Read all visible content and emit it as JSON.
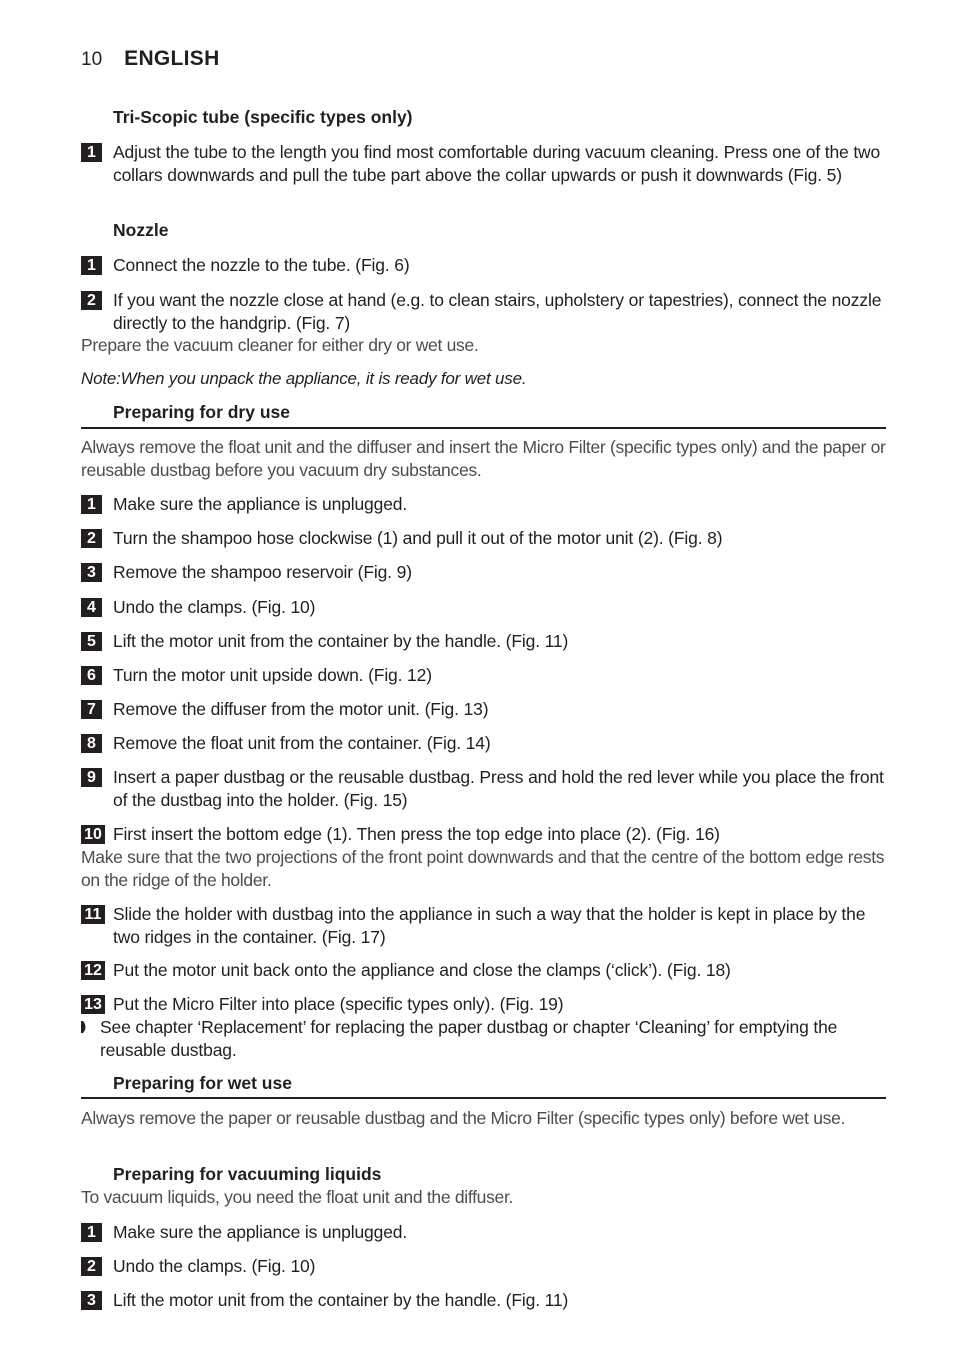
{
  "header": {
    "page_number": "10",
    "language": "ENGLISH"
  },
  "sections": {
    "tri_scopic": {
      "title": "Tri-Scopic tube (specific types only)",
      "steps": [
        {
          "num": "1",
          "text": "Adjust the tube to the length you find most comfortable during vacuum cleaning. Press one of the two collars downwards and pull the tube part above the collar upwards or push it downwards (Fig. 5)"
        }
      ]
    },
    "nozzle": {
      "title": "Nozzle",
      "steps": [
        {
          "num": "1",
          "text": "Connect the nozzle to the tube. (Fig. 6)"
        },
        {
          "num": "2",
          "text": "If you want the nozzle close at hand (e.g. to clean stairs, upholstery or tapestries), connect the nozzle directly to the handgrip. (Fig. 7)"
        }
      ],
      "after_text": "Prepare the vacuum cleaner for either dry or wet use.",
      "note": "Note:When you unpack the appliance, it is ready for wet use."
    },
    "dry_use": {
      "title": "Preparing for dry use",
      "intro": "Always remove the float unit and the diffuser and insert the Micro Filter (specific types only) and the paper or reusable dustbag before you vacuum dry substances.",
      "steps": [
        {
          "num": "1",
          "text": "Make sure the appliance is unplugged."
        },
        {
          "num": "2",
          "text": "Turn the shampoo hose clockwise (1) and pull it out of the motor unit (2). (Fig. 8)"
        },
        {
          "num": "3",
          "text": "Remove the shampoo reservoir (Fig. 9)"
        },
        {
          "num": "4",
          "text": "Undo the clamps. (Fig. 10)"
        },
        {
          "num": "5",
          "text": "Lift the motor unit from the container by the handle. (Fig. 11)"
        },
        {
          "num": "6",
          "text": "Turn the motor unit upside down. (Fig. 12)"
        },
        {
          "num": "7",
          "text": "Remove the diffuser from the motor unit. (Fig. 13)"
        },
        {
          "num": "8",
          "text": "Remove the float unit from the container. (Fig. 14)"
        },
        {
          "num": "9",
          "text": "Insert a paper dustbag or the reusable dustbag. Press and hold the red lever while you place the front of the dustbag into the holder. (Fig. 15)"
        },
        {
          "num": "10",
          "text": "First insert the bottom edge (1). Then press the top edge into place (2). (Fig. 16)"
        },
        {
          "num": "11",
          "text": "Slide the holder with dustbag into the appliance in such a way that the holder is kept in place by the two ridges in the container. (Fig. 17)"
        },
        {
          "num": "12",
          "text": "Put the motor unit back onto the appliance and close the clamps (‘click’).  (Fig. 18)"
        },
        {
          "num": "13",
          "text": "Put the Micro Filter into place (specific types only). (Fig. 19)"
        }
      ],
      "step10_note": "Make sure that the two projections of the front point downwards and that the centre of the bottom edge rests on the ridge of the holder.",
      "bullet": "See chapter ‘Replacement’ for replacing the paper dustbag or chapter ‘Cleaning’ for emptying the reusable dustbag."
    },
    "wet_use": {
      "title": "Preparing for wet use",
      "intro": "Always remove the paper or reusable dustbag and the Micro Filter (specific types only) before wet use."
    },
    "liquids": {
      "title": "Preparing for vacuuming liquids",
      "intro": "To vacuum liquids, you need the float unit and the diffuser.",
      "steps": [
        {
          "num": "1",
          "text": "Make sure the appliance is unplugged."
        },
        {
          "num": "2",
          "text": "Undo the clamps. (Fig. 10)"
        },
        {
          "num": "3",
          "text": "Lift the motor unit from the container by the handle. (Fig. 11)"
        }
      ]
    }
  }
}
